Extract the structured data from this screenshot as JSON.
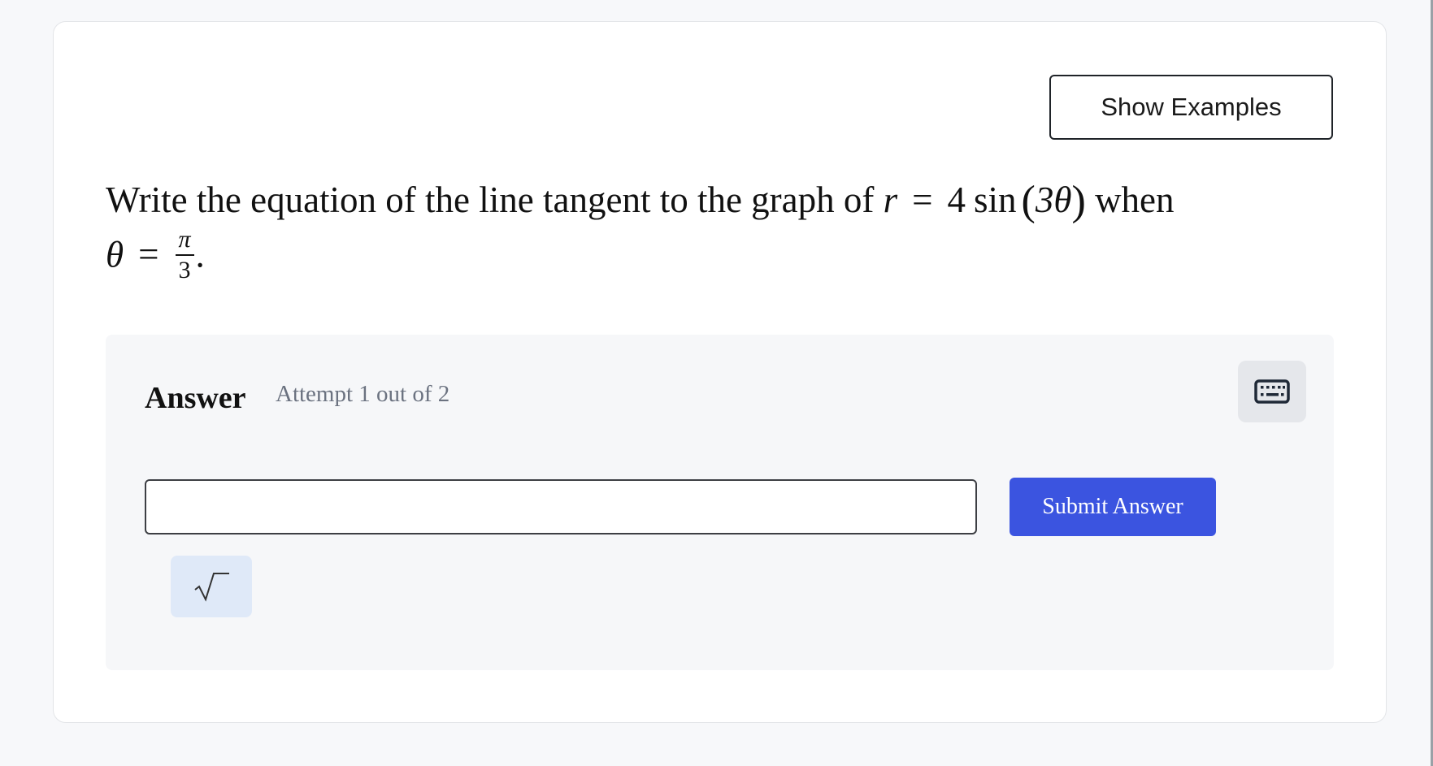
{
  "toolbar": {
    "show_examples_label": "Show Examples"
  },
  "question": {
    "text_prefix": "Write the equation of the line tangent to the graph of",
    "eq_lhs_var": "r",
    "eq_equals": "=",
    "eq_coeff": "4",
    "eq_fn": "sin",
    "eq_arg_open": "(",
    "eq_arg": "3θ",
    "eq_arg_close": ")",
    "text_when": "when",
    "cond_var": "θ",
    "cond_equals": "=",
    "cond_num": "π",
    "cond_den": "3",
    "cond_end": "."
  },
  "answer": {
    "label": "Answer",
    "attempt": "Attempt 1 out of 2",
    "input_value": "",
    "input_placeholder": "",
    "submit_label": "Submit Answer"
  },
  "icons": {
    "keyboard": "keyboard-icon",
    "sqrt": "square-root-icon"
  },
  "colors": {
    "submit_bg": "#3b54e0",
    "sqrt_bg": "#dfe9f8",
    "keyboard_bg": "#e5e7eb",
    "attempt_text": "#6b7280"
  }
}
